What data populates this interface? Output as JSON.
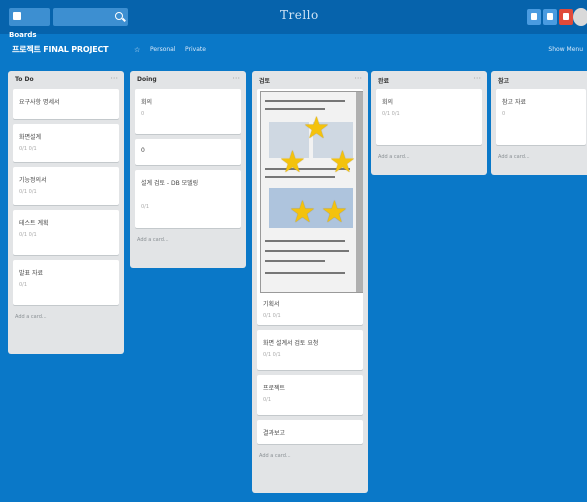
{
  "header": {
    "boards_label": "Boards",
    "search_placeholder": "",
    "logo": "Trello"
  },
  "board": {
    "title": "프로젝트 FINAL PROJECT",
    "visibility": "Personal",
    "privacy": "Private",
    "show_menu": "Show Menu"
  },
  "lists": [
    {
      "title": "To Do",
      "cards": [
        {
          "title": "요구사항 명세서",
          "meta": ""
        },
        {
          "title": "화면설계",
          "meta": "0/1  0/1"
        },
        {
          "title": "기능정의서",
          "meta": "0/1  0/1"
        },
        {
          "title": "테스트 계획",
          "meta": "0/1  0/1"
        },
        {
          "title": "발표 자료",
          "meta": "0/1"
        }
      ],
      "add_label": "Add a card..."
    },
    {
      "title": "Doing",
      "cards": [
        {
          "title": "회의",
          "meta": "0"
        },
        {
          "title": "0",
          "meta": ""
        },
        {
          "title": "설계 검토 - DB 모델링",
          "meta": "0/1"
        }
      ],
      "add_label": "Add a card..."
    },
    {
      "title": "검토",
      "cards": [
        {
          "title": "기획서",
          "meta": "0/1  0/1"
        },
        {
          "title": "화면 설계서 검토 요청",
          "meta": "0/1  0/1"
        },
        {
          "title": "프로젝트",
          "meta": "0/1"
        },
        {
          "title": "결과보고",
          "meta": ""
        }
      ],
      "add_label": "Add a card..."
    },
    {
      "title": "완료",
      "cards": [
        {
          "title": "회의",
          "meta": "0/1  0/1"
        }
      ],
      "add_label": "Add a card..."
    },
    {
      "title": "참고",
      "cards": [
        {
          "title": "참고 자료",
          "meta": "0"
        }
      ],
      "add_label": "Add a card..."
    }
  ],
  "colors": {
    "board_bg": "#0a78c8",
    "header_bg": "#0663ac",
    "list_bg": "#e2e4e6",
    "star": "#f4c20d"
  }
}
